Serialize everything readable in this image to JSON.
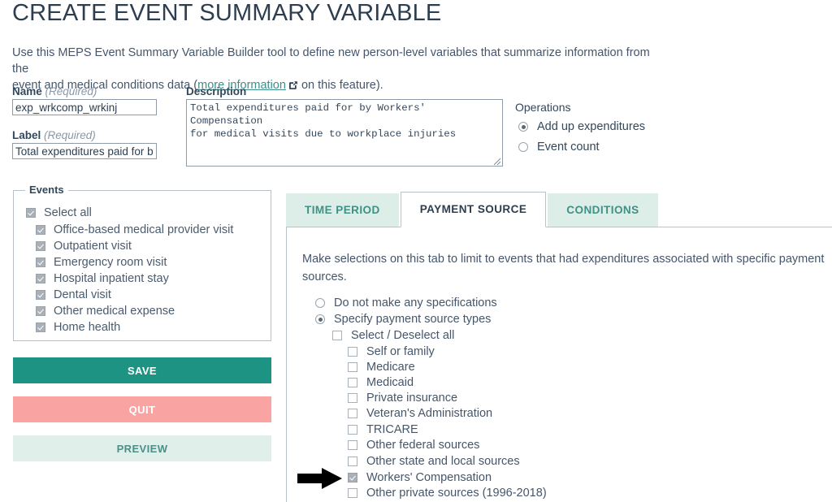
{
  "page_title": "CREATE EVENT SUMMARY VARIABLE",
  "intro": {
    "line1": "Use this MEPS Event Summary Variable Builder tool to define new person-level variables that summarize information from the",
    "line2_prefix": "event and medical conditions data (",
    "link_text": "more information",
    "link_icon": "external-link-icon",
    "line2_suffix": " on this feature)."
  },
  "form": {
    "name_label": "Name",
    "name_required": "(Required)",
    "name_value": "exp_wrkcomp_wrkinj",
    "label_label": "Label",
    "label_required": "(Required)",
    "label_value": "Total expenditures paid for by Workers' Compensation for medical visits due to workplace injuries",
    "description_label": "Description",
    "description_value": "Total expenditures paid for by Workers' Compensation\nfor medical visits due to workplace injuries"
  },
  "operations": {
    "title": "Operations",
    "options": [
      {
        "label": "Add up expenditures",
        "selected": true
      },
      {
        "label": "Event count",
        "selected": false
      }
    ]
  },
  "events": {
    "legend": "Events",
    "select_all": {
      "label": "Select all",
      "checked": true
    },
    "items": [
      {
        "label": "Office-based medical provider visit",
        "checked": true
      },
      {
        "label": "Outpatient visit",
        "checked": true
      },
      {
        "label": "Emergency room visit",
        "checked": true
      },
      {
        "label": "Hospital inpatient stay",
        "checked": true
      },
      {
        "label": "Dental visit",
        "checked": true
      },
      {
        "label": "Other medical expense",
        "checked": true
      },
      {
        "label": "Home health",
        "checked": true
      }
    ]
  },
  "buttons": {
    "save": "SAVE",
    "quit": "QUIT",
    "preview": "PREVIEW"
  },
  "colors": {
    "save_bg": "#1d9384",
    "quit_bg": "#f9a3a2",
    "preview_bg": "#e0efea",
    "preview_text": "#4c8f87",
    "tab_inactive_bg": "#dceee7",
    "tab_inactive_text": "#3f9085",
    "link": "#3d8e86",
    "body_text": "#45566b"
  },
  "tabs": [
    {
      "label": "TIME PERIOD",
      "active": false
    },
    {
      "label": "PAYMENT SOURCE",
      "active": true
    },
    {
      "label": "CONDITIONS",
      "active": false
    }
  ],
  "payment_source": {
    "description": "Make selections on this tab to limit to events that had expenditures associated with specific payment sources.",
    "mode_options": [
      {
        "label": "Do not make any specifications",
        "selected": false
      },
      {
        "label": "Specify payment source types",
        "selected": true
      }
    ],
    "select_deselect_all": {
      "label": "Select / Deselect all",
      "checked": false
    },
    "sources": [
      {
        "label": "Self or family",
        "checked": false,
        "annotated": false
      },
      {
        "label": "Medicare",
        "checked": false,
        "annotated": false
      },
      {
        "label": "Medicaid",
        "checked": false,
        "annotated": false
      },
      {
        "label": "Private insurance",
        "checked": false,
        "annotated": false
      },
      {
        "label": "Veteran's Administration",
        "checked": false,
        "annotated": false
      },
      {
        "label": "TRICARE",
        "checked": false,
        "annotated": false
      },
      {
        "label": "Other federal sources",
        "checked": false,
        "annotated": false
      },
      {
        "label": "Other state and local sources",
        "checked": false,
        "annotated": false
      },
      {
        "label": "Workers' Compensation",
        "checked": true,
        "annotated": true
      },
      {
        "label": "Other private sources (1996-2018)",
        "checked": false,
        "annotated": false
      }
    ]
  }
}
